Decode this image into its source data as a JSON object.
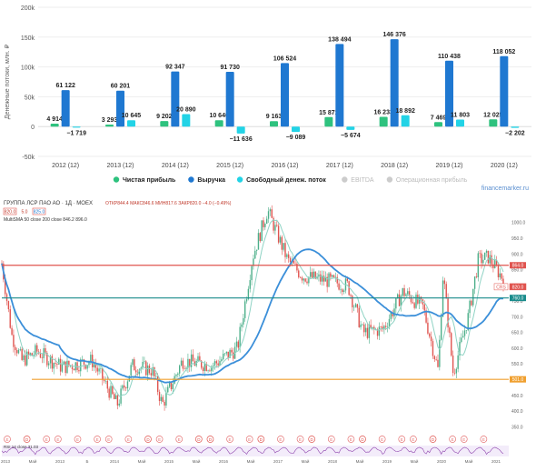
{
  "chart_data": [
    {
      "type": "bar",
      "categories": [
        "2012 (12)",
        "2013 (12)",
        "2014 (12)",
        "2015 (12)",
        "2016 (12)",
        "2017 (12)",
        "2018 (12)",
        "2019 (12)",
        "2020 (12)"
      ],
      "ylabel": "Денежные потоки, млн. ₽",
      "yticks": [
        "200k",
        "150k",
        "100k",
        "50k",
        "0",
        "-50k"
      ],
      "ylim": [
        -50000,
        200000
      ],
      "legend_position": "bottom",
      "watermark": "financemarker.ru",
      "series": [
        {
          "name": "Чистая прибыль",
          "color": "#2ec27e",
          "values": [
            4914,
            3293,
            9202,
            10646,
            9163,
            15871,
            16233,
            7469,
            12025
          ],
          "labels": [
            "4 914",
            "3 293",
            "9 202",
            "10 646",
            "9 163",
            "15 871",
            "16 233",
            "7 469",
            "12 025"
          ]
        },
        {
          "name": "Выручка",
          "color": "#1f78d1",
          "values": [
            61122,
            60201,
            92347,
            91730,
            106524,
            138494,
            146376,
            110438,
            118052
          ],
          "labels": [
            "61 122",
            "60 201",
            "92 347",
            "91 730",
            "106 524",
            "138 494",
            "146 376",
            "110 438",
            "118 052"
          ]
        },
        {
          "name": "Свободный денеж. поток",
          "color": "#22d3e6",
          "values": [
            -1719,
            10645,
            20890,
            -11636,
            -9089,
            -5674,
            18892,
            11803,
            -2202
          ],
          "labels": [
            "−1 719",
            "10 645",
            "20 890",
            "−11 636",
            "−9 089",
            "−5 674",
            "18 892",
            "11 803",
            "−2 202"
          ]
        },
        {
          "name": "EBITDA",
          "color": "#cccccc",
          "values": []
        },
        {
          "name": "Операционная прибыль",
          "color": "#cccccc",
          "values": []
        }
      ]
    },
    {
      "type": "line",
      "title": "ГРУППА ЛСР ПАО АО · 1Д · MOEX",
      "ohlc": "ОТКР844.4 МАКС846.6 МИН817.6 ЗАКР820.0 −4.0 (−0.49%)",
      "price_boxes": [
        "820.0",
        "5.0",
        "825.0"
      ],
      "ma_legend": "MultiSMA 50 close 200 close 846.2 896.0",
      "rsi_legend": "RSI 14 close 31.03",
      "yticks": [
        "1000.0",
        "950.0",
        "900.0",
        "850.0",
        "800.0",
        "750.0",
        "700.0",
        "650.0",
        "600.0",
        "550.0",
        "500.0",
        "450.0",
        "400.0",
        "350.0"
      ],
      "xticks": [
        "2013",
        "Май",
        "2013",
        "Б",
        "2014",
        "Май",
        "2015",
        "Май",
        "2016",
        "Май",
        "2017",
        "Май",
        "2018",
        "Май",
        "2019",
        "Май",
        "2020",
        "Май",
        "2021"
      ],
      "horizontal_levels": [
        {
          "value": 864.0,
          "label": "864.0",
          "color": "#e0544f"
        },
        {
          "value": 760.0,
          "label": "760.0",
          "color": "#1a8c8c"
        },
        {
          "value": 501.0,
          "label": "501.0",
          "color": "#f0a030"
        }
      ],
      "price_tags": [
        {
          "label": "CRS",
          "color": "#e0544f"
        },
        {
          "label": "820.0",
          "color": "#e0544f"
        }
      ],
      "sma200_color": "#3b8fd9",
      "sma50_color": "#8fd3c4",
      "candle_up": "#4caf8a",
      "candle_down": "#e0544f",
      "event_markers": [
        "E",
        "D",
        "E",
        "E",
        "E",
        "E",
        "E",
        "E",
        "D",
        "E",
        "E",
        "D",
        "D",
        "E",
        "E",
        "D",
        "E",
        "E",
        "D",
        "E",
        "E",
        "D",
        "E",
        "E",
        "E",
        "D",
        "E",
        "E",
        "E"
      ]
    }
  ]
}
